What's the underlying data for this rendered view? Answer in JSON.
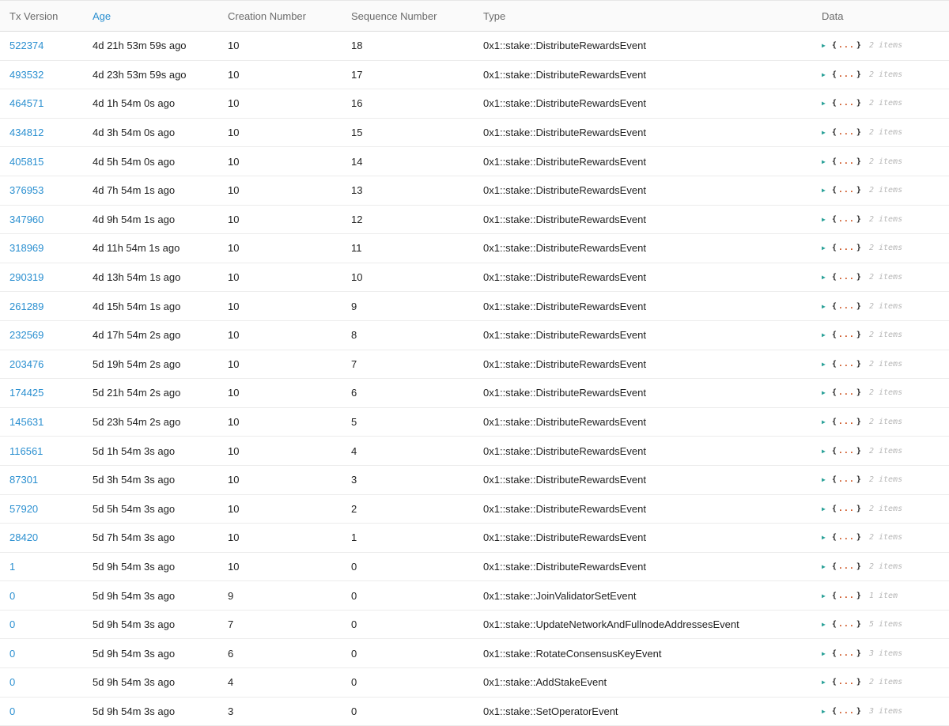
{
  "headers": [
    "Tx Version",
    "Age",
    "Creation Number",
    "Sequence Number",
    "Type",
    "Data"
  ],
  "rows": [
    {
      "version": "522374",
      "age": "4d 21h 53m 59s ago",
      "creation": "10",
      "sequence": "18",
      "type": "0x1::stake::DistributeRewardsEvent",
      "items": "2 items"
    },
    {
      "version": "493532",
      "age": "4d 23h 53m 59s ago",
      "creation": "10",
      "sequence": "17",
      "type": "0x1::stake::DistributeRewardsEvent",
      "items": "2 items"
    },
    {
      "version": "464571",
      "age": "4d 1h 54m 0s ago",
      "creation": "10",
      "sequence": "16",
      "type": "0x1::stake::DistributeRewardsEvent",
      "items": "2 items"
    },
    {
      "version": "434812",
      "age": "4d 3h 54m 0s ago",
      "creation": "10",
      "sequence": "15",
      "type": "0x1::stake::DistributeRewardsEvent",
      "items": "2 items"
    },
    {
      "version": "405815",
      "age": "4d 5h 54m 0s ago",
      "creation": "10",
      "sequence": "14",
      "type": "0x1::stake::DistributeRewardsEvent",
      "items": "2 items"
    },
    {
      "version": "376953",
      "age": "4d 7h 54m 1s ago",
      "creation": "10",
      "sequence": "13",
      "type": "0x1::stake::DistributeRewardsEvent",
      "items": "2 items"
    },
    {
      "version": "347960",
      "age": "4d 9h 54m 1s ago",
      "creation": "10",
      "sequence": "12",
      "type": "0x1::stake::DistributeRewardsEvent",
      "items": "2 items"
    },
    {
      "version": "318969",
      "age": "4d 11h 54m 1s ago",
      "creation": "10",
      "sequence": "11",
      "type": "0x1::stake::DistributeRewardsEvent",
      "items": "2 items"
    },
    {
      "version": "290319",
      "age": "4d 13h 54m 1s ago",
      "creation": "10",
      "sequence": "10",
      "type": "0x1::stake::DistributeRewardsEvent",
      "items": "2 items"
    },
    {
      "version": "261289",
      "age": "4d 15h 54m 1s ago",
      "creation": "10",
      "sequence": "9",
      "type": "0x1::stake::DistributeRewardsEvent",
      "items": "2 items"
    },
    {
      "version": "232569",
      "age": "4d 17h 54m 2s ago",
      "creation": "10",
      "sequence": "8",
      "type": "0x1::stake::DistributeRewardsEvent",
      "items": "2 items"
    },
    {
      "version": "203476",
      "age": "5d 19h 54m 2s ago",
      "creation": "10",
      "sequence": "7",
      "type": "0x1::stake::DistributeRewardsEvent",
      "items": "2 items"
    },
    {
      "version": "174425",
      "age": "5d 21h 54m 2s ago",
      "creation": "10",
      "sequence": "6",
      "type": "0x1::stake::DistributeRewardsEvent",
      "items": "2 items"
    },
    {
      "version": "145631",
      "age": "5d 23h 54m 2s ago",
      "creation": "10",
      "sequence": "5",
      "type": "0x1::stake::DistributeRewardsEvent",
      "items": "2 items"
    },
    {
      "version": "116561",
      "age": "5d 1h 54m 3s ago",
      "creation": "10",
      "sequence": "4",
      "type": "0x1::stake::DistributeRewardsEvent",
      "items": "2 items"
    },
    {
      "version": "87301",
      "age": "5d 3h 54m 3s ago",
      "creation": "10",
      "sequence": "3",
      "type": "0x1::stake::DistributeRewardsEvent",
      "items": "2 items"
    },
    {
      "version": "57920",
      "age": "5d 5h 54m 3s ago",
      "creation": "10",
      "sequence": "2",
      "type": "0x1::stake::DistributeRewardsEvent",
      "items": "2 items"
    },
    {
      "version": "28420",
      "age": "5d 7h 54m 3s ago",
      "creation": "10",
      "sequence": "1",
      "type": "0x1::stake::DistributeRewardsEvent",
      "items": "2 items"
    },
    {
      "version": "1",
      "age": "5d 9h 54m 3s ago",
      "creation": "10",
      "sequence": "0",
      "type": "0x1::stake::DistributeRewardsEvent",
      "items": "2 items"
    },
    {
      "version": "0",
      "age": "5d 9h 54m 3s ago",
      "creation": "9",
      "sequence": "0",
      "type": "0x1::stake::JoinValidatorSetEvent",
      "items": "1 item"
    },
    {
      "version": "0",
      "age": "5d 9h 54m 3s ago",
      "creation": "7",
      "sequence": "0",
      "type": "0x1::stake::UpdateNetworkAndFullnodeAddressesEvent",
      "items": "5 items"
    },
    {
      "version": "0",
      "age": "5d 9h 54m 3s ago",
      "creation": "6",
      "sequence": "0",
      "type": "0x1::stake::RotateConsensusKeyEvent",
      "items": "3 items"
    },
    {
      "version": "0",
      "age": "5d 9h 54m 3s ago",
      "creation": "4",
      "sequence": "0",
      "type": "0x1::stake::AddStakeEvent",
      "items": "2 items"
    },
    {
      "version": "0",
      "age": "5d 9h 54m 3s ago",
      "creation": "3",
      "sequence": "0",
      "type": "0x1::stake::SetOperatorEvent",
      "items": "3 items"
    }
  ],
  "icons": {
    "expand": "caret-right-icon",
    "brace_open": "{",
    "dots": "...",
    "brace_close": "}"
  },
  "colors": {
    "link": "#2a8fd0",
    "caret": "#2aa198",
    "dots": "#cb4b16",
    "muted": "#b5b5b5"
  }
}
